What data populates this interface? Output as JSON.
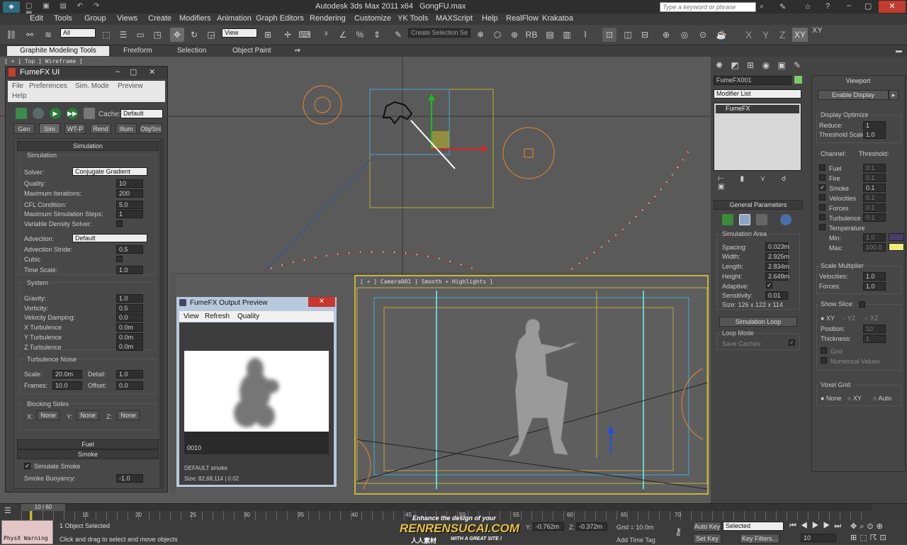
{
  "titlebar": {
    "app_title": "Autodesk 3ds Max  2011 x64",
    "file_name": "GongFU.max",
    "search_placeholder": "Type a keyword or phrase"
  },
  "menu": [
    "Edit",
    "Tools",
    "Group",
    "Views",
    "Create",
    "Modifiers",
    "Animation",
    "Graph Editors",
    "Rendering",
    "Customize",
    "YK Tools",
    "MAXScript",
    "Help",
    "RealFlow",
    "Krakatoa"
  ],
  "toolbar": {
    "filter_value": "All",
    "refcoord_value": "View",
    "selection_set_placeholder": "Create Selection Se",
    "axis_labels": [
      "X",
      "Y",
      "Z",
      "XY",
      "XY"
    ]
  },
  "ribbon": {
    "tabs": [
      "Graphite Modeling Tools",
      "Freeform",
      "Selection",
      "Object Paint"
    ]
  },
  "viewport_top": {
    "label": "[ + ] Top ] Wireframe ]"
  },
  "viewport_camera": {
    "label": "[ + ] Camera001 ] Smooth + Highlights ]"
  },
  "fumefx": {
    "title": "FumeFX UI",
    "menu": [
      "File",
      "Preferences",
      "Sim. Mode",
      "Preview",
      "Help"
    ],
    "cache_label": "Cache:",
    "cache_value": "Default",
    "tabs": [
      "Gen",
      "Sim",
      "WT-P",
      "Rend",
      "Illum",
      "Obj/Src"
    ],
    "simulation_header": "Simulation",
    "simulation_group": "Simulation",
    "solver_label": "Solver:",
    "solver_value": "Conjugate Gradient",
    "quality_label": "Quality:",
    "quality_value": "10",
    "max_iter_label": "Maximum Iterations:",
    "max_iter_value": "200",
    "cfl_label": "CFL Condition:",
    "cfl_value": "5.0",
    "max_steps_label": "Maximum Simulation Steps:",
    "max_steps_value": "1",
    "var_density_label": "Variable Density Solver:",
    "advection_label": "Advection:",
    "advection_value": "Default",
    "adv_stride_label": "Advection Stride:",
    "adv_stride_value": "0.5",
    "cubic_label": "Cubic",
    "time_scale_label": "Time Scale:",
    "time_scale_value": "1.0",
    "system_group": "System",
    "gravity_label": "Gravity:",
    "gravity_value": "1.0",
    "vorticity_label": "Vorticity:",
    "vorticity_value": "0.5",
    "vel_damp_label": "Velocity Damping:",
    "vel_damp_value": "0.0",
    "xturb_label": "X Turbulence",
    "xturb_value": "0.0m",
    "yturb_label": "Y Turbulence",
    "yturb_value": "0.0m",
    "zturb_label": "Z Turbulence",
    "zturb_value": "0.0m",
    "turb_noise_group": "Turbulence Noise",
    "scale_label": "Scale:",
    "scale_value": "20.0m",
    "detail_label": "Detail:",
    "detail_value": "1.0",
    "frames_label": "Frames:",
    "frames_value": "10.0",
    "offset_label": "Offset:",
    "offset_value": "0.0",
    "blocking_group": "Blocking Sides",
    "x_label": "X:",
    "y_label": "Y:",
    "z_label": "Z:",
    "none": "None",
    "fuel_header": "Fuel",
    "smoke_header": "Smoke",
    "simulate_smoke_label": "Simulate Smoke",
    "smoke_buoyancy_label": "Smoke Buoyancy:",
    "smoke_buoyancy_value": "-1.0"
  },
  "preview": {
    "title": "FumeFX Output Preview",
    "menu": [
      "View",
      "Refresh",
      "Quality"
    ],
    "frame": "0010",
    "channel": "DEFAULT smoke",
    "size": "Size: 82,68,114 | 0.02"
  },
  "cmd": {
    "object_name": "FumeFX001",
    "modifier_list": "Modifier List",
    "stack_item": "FumeFX",
    "general_params": "General Parameters",
    "sim_area": "Simulation Area",
    "spacing_label": "Spacing:",
    "spacing_value": "0.023m",
    "width_label": "Width:",
    "width_value": "2.925m",
    "length_label": "Length:",
    "length_value": "2.834m",
    "height_label": "Height:",
    "height_value": "2.649m",
    "adaptive_label": "Adaptive:",
    "sensitivity_label": "Sensitivity:",
    "sensitivity_value": "0.01",
    "size_text": "Size: 126 x 122 x 114",
    "sim_loop_button": "Simulation Loop",
    "loop_mode_group": "Loop Mode",
    "save_caches_label": "Save Caches:"
  },
  "viewport_panel": {
    "header": "Viewport",
    "enable_display": "Enable Display",
    "display_optimize": "Display Optimize",
    "reduce_label": "Reduce:",
    "reduce_value": "1",
    "threshold_scale_label": "Threshold Scale:",
    "threshold_scale_value": "1.0",
    "channel_label": "Channel:",
    "threshold_label": "Threshold:",
    "channels": [
      {
        "name": "Fuel",
        "checked": false,
        "value": "0.1"
      },
      {
        "name": "Fire",
        "checked": false,
        "value": "0.1"
      },
      {
        "name": "Smoke",
        "checked": true,
        "value": "0.1"
      },
      {
        "name": "Velocities",
        "checked": false,
        "value": "0.1"
      },
      {
        "name": "Forces",
        "checked": false,
        "value": "0.1"
      },
      {
        "name": "Turbulence",
        "checked": false,
        "value": "0.1"
      }
    ],
    "temperature_label": "Temperature",
    "min_label": "Min:",
    "min_value": "1.0",
    "max_label": "Max:",
    "max_value": "100.0",
    "scale_multiplier": "Scale Multiplier",
    "velocities_label": "Velocities:",
    "velocities_value": "1.0",
    "forces_label": "Forces:",
    "forces_value": "1.0",
    "show_slice": "Show Slice:",
    "xy": "XY",
    "yz": "YZ",
    "xz": "XZ",
    "position_label": "Position:",
    "position_value": "10",
    "thickness_label": "Thickness:",
    "thickness_value": "1",
    "grid_label": "Grid",
    "numerical_label": "Numerical Values",
    "voxel_grid": "Voxel Grid:",
    "none": "None",
    "auto": "Auto",
    "colors": {
      "min": "#4a3d6b",
      "max": "#f1e97a"
    }
  },
  "timeline": {
    "frame_counter": "10 / 60",
    "ticks": [
      "15",
      "20",
      "25",
      "30",
      "35",
      "40",
      "45",
      "50",
      "55",
      "60",
      "65",
      "70"
    ]
  },
  "statusbar": {
    "warning": "PhysX Warning",
    "selected": "1 Object Selected",
    "prompt": "Click and drag to select and move objects",
    "y_label": "Y:",
    "y_value": "-0.762m",
    "z_label": "Z:",
    "z_value": "-0.372m",
    "grid": "Grid = 10.0m",
    "add_time_tag": "Add Time Tag",
    "auto_key": "Auto Key",
    "set_key": "Set Key",
    "selected_dropdown": "Selected",
    "key_filters": "Key Filters...",
    "current_frame": "10"
  },
  "watermark": {
    "tagline": "Enhance the design of your",
    "brand": "RENRENSUCAI.COM",
    "cn": "人人素材",
    "slogan": "WITH A GREAT SITE !"
  }
}
